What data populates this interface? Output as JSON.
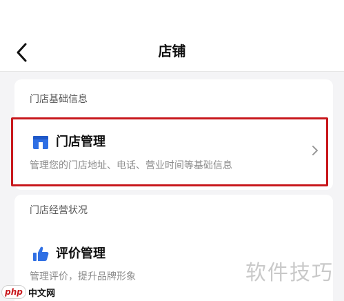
{
  "navbar": {
    "title": "店铺",
    "back_icon": "chevron-left-icon"
  },
  "store_info_section": {
    "title": "门店基础信息",
    "item": {
      "title": "门店管理",
      "description": "管理您的门店地址、电话、营业时间等基础信息",
      "icon": "store-icon",
      "icon_color": "#2f6fe4"
    },
    "highlight_color": "#c8171c"
  },
  "operation_section": {
    "title": "门店经营状况",
    "item": {
      "title": "评价管理",
      "description": "管理评价，提升品牌形象",
      "icon": "thumbs-up-icon",
      "icon_color": "#2f6fe4"
    }
  },
  "watermark": {
    "text": "软件技巧",
    "logo_badge": "php",
    "logo_text": "中文网"
  }
}
